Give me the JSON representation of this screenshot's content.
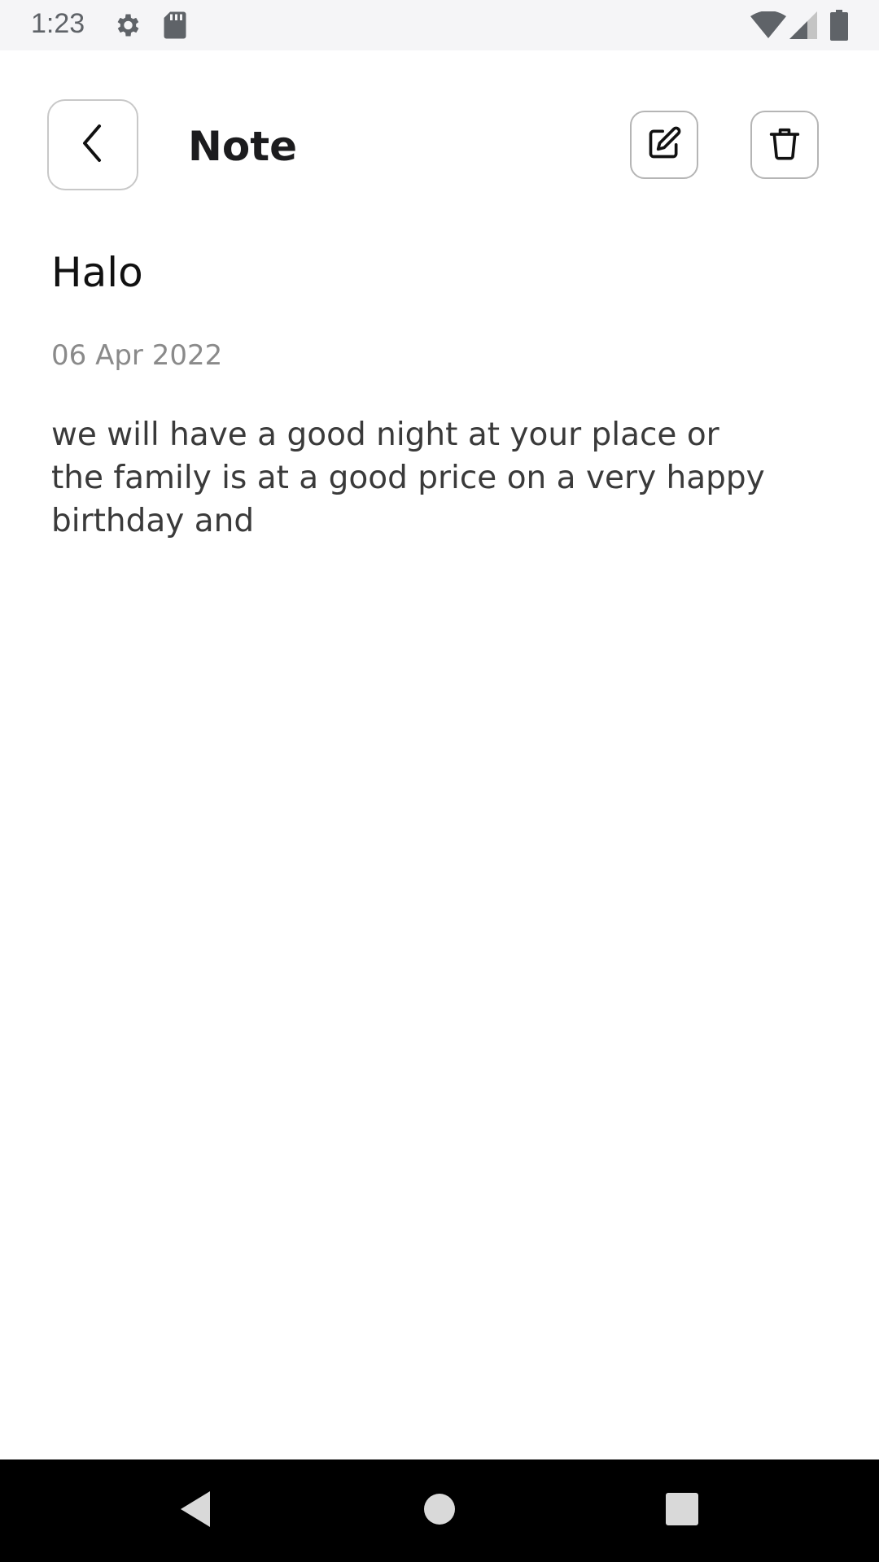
{
  "status_bar": {
    "time": "1:23",
    "icons": [
      "settings-icon",
      "sd-card-icon",
      "wifi-icon",
      "signal-icon",
      "battery-icon"
    ]
  },
  "header": {
    "title": "Note",
    "buttons": [
      "back-icon",
      "edit-icon",
      "trash-icon"
    ]
  },
  "note": {
    "title": "Halo",
    "date": "06 Apr 2022",
    "body": "we will have a good night at your place or\nthe family is at a good price on a very happy\nbirthday and"
  },
  "nav_bar": {
    "buttons": [
      "nav-back-icon",
      "nav-home-icon",
      "nav-recents-icon"
    ]
  },
  "colors": {
    "status_bar_bg": "#f5f5f7",
    "text_primary": "#111111",
    "text_secondary": "#8a8a8a",
    "nav_bar_bg": "#000000"
  }
}
